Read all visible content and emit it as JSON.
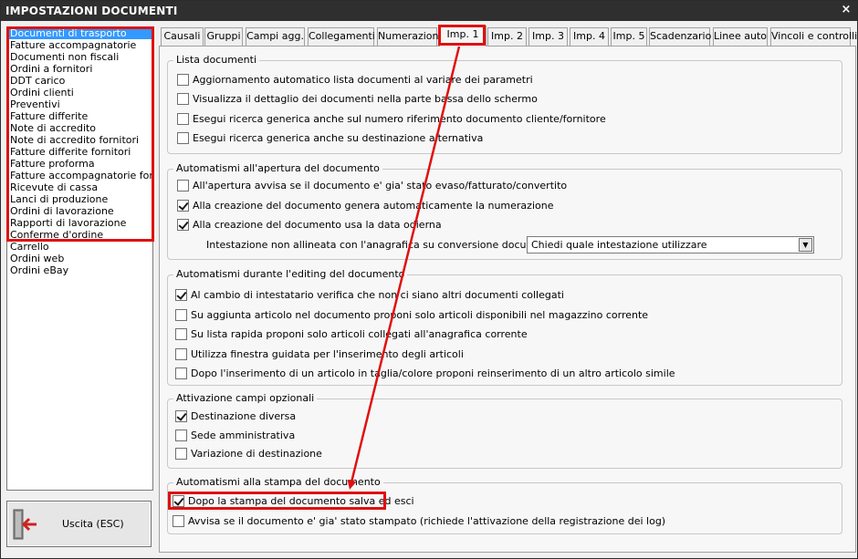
{
  "window": {
    "title": "IMPOSTAZIONI DOCUMENTI",
    "close_label": "×"
  },
  "doc_list": {
    "items": [
      {
        "label": "Documenti di trasporto",
        "selected": true
      },
      {
        "label": "Fatture accompagnatorie"
      },
      {
        "label": "Documenti non fiscali"
      },
      {
        "label": "Ordini a fornitori"
      },
      {
        "label": "DDT carico"
      },
      {
        "label": "Ordini clienti"
      },
      {
        "label": "Preventivi"
      },
      {
        "label": "Fatture differite"
      },
      {
        "label": "Note di accredito"
      },
      {
        "label": "Note di accredito fornitori"
      },
      {
        "label": "Fatture differite fornitori"
      },
      {
        "label": "Fatture proforma"
      },
      {
        "label": "Fatture accompagnatorie fornito"
      },
      {
        "label": "Ricevute di cassa"
      },
      {
        "label": "Lanci di produzione"
      },
      {
        "label": "Ordini di lavorazione"
      },
      {
        "label": "Rapporti di lavorazione"
      },
      {
        "label": "Conferme d'ordine"
      },
      {
        "label": "Carrello"
      },
      {
        "label": "Ordini web"
      },
      {
        "label": "Ordini eBay"
      }
    ]
  },
  "exit_button": {
    "label": "Uscita (ESC)",
    "icon": "exit-door-icon"
  },
  "tabs": [
    {
      "label": "Causali"
    },
    {
      "label": "Gruppi"
    },
    {
      "label": "Campi agg."
    },
    {
      "label": "Collegamenti"
    },
    {
      "label": "Numerazioni"
    },
    {
      "label": "Imp. 1",
      "active": true
    },
    {
      "label": "Imp. 2"
    },
    {
      "label": "Imp. 3"
    },
    {
      "label": "Imp. 4"
    },
    {
      "label": "Imp. 5"
    },
    {
      "label": "Scadenzario"
    },
    {
      "label": "Linee auto"
    },
    {
      "label": "Vincoli e controlli"
    }
  ],
  "groups": {
    "lista": {
      "title": "Lista documenti",
      "options": [
        {
          "label": "Aggiornamento automatico lista documenti al variare dei parametri",
          "checked": false
        },
        {
          "label": "Visualizza il dettaglio dei documenti nella parte bassa dello schermo",
          "checked": false
        },
        {
          "label": "Esegui ricerca generica anche sul numero riferimento documento cliente/fornitore",
          "checked": false
        },
        {
          "label": "Esegui ricerca generica anche su destinazione alternativa",
          "checked": false
        }
      ]
    },
    "apertura": {
      "title": "Automatismi all'apertura del documento",
      "options": [
        {
          "label": "All'apertura avvisa se il documento e' gia' stato evaso/fatturato/convertito",
          "checked": false
        },
        {
          "label": "Alla creazione del documento genera automaticamente la numerazione",
          "checked": true
        },
        {
          "label": "Alla creazione del documento usa la data odierna",
          "checked": true
        }
      ],
      "intestazione_label": "Intestazione non allineata con l'anagrafica su conversione documento :",
      "intestazione_value": "Chiedi quale intestazione utilizzare"
    },
    "editing": {
      "title": "Automatismi durante l'editing del documento",
      "options": [
        {
          "label": "Al cambio di intestatario verifica che non ci siano altri documenti collegati",
          "checked": true
        },
        {
          "label": "Su aggiunta articolo nel documento proponi solo articoli disponibili nel magazzino corrente",
          "checked": false
        },
        {
          "label": "Su lista rapida proponi solo articoli collegati all'anagrafica corrente",
          "checked": false
        },
        {
          "label": "Utilizza finestra guidata per l'inserimento degli articoli",
          "checked": false
        },
        {
          "label": "Dopo l'inserimento di un articolo in taglia/colore proponi reinserimento di un altro articolo simile",
          "checked": false
        }
      ]
    },
    "campi": {
      "title": "Attivazione campi opzionali",
      "options": [
        {
          "label": "Destinazione diversa",
          "checked": true
        },
        {
          "label": "Sede amministrativa",
          "checked": false
        },
        {
          "label": "Variazione di destinazione",
          "checked": false
        }
      ]
    },
    "stampa": {
      "title": "Automatismi alla stampa del documento",
      "options": [
        {
          "label": "Dopo la stampa del documento salva ed esci",
          "checked": true
        },
        {
          "label": "Avvisa se il documento e' gia' stato stampato (richiede l'attivazione della registrazione dei log)",
          "checked": false
        }
      ]
    }
  },
  "colors": {
    "highlight": "#e01010",
    "selection": "#3399ff",
    "titlebar": "#2f2f2f"
  }
}
